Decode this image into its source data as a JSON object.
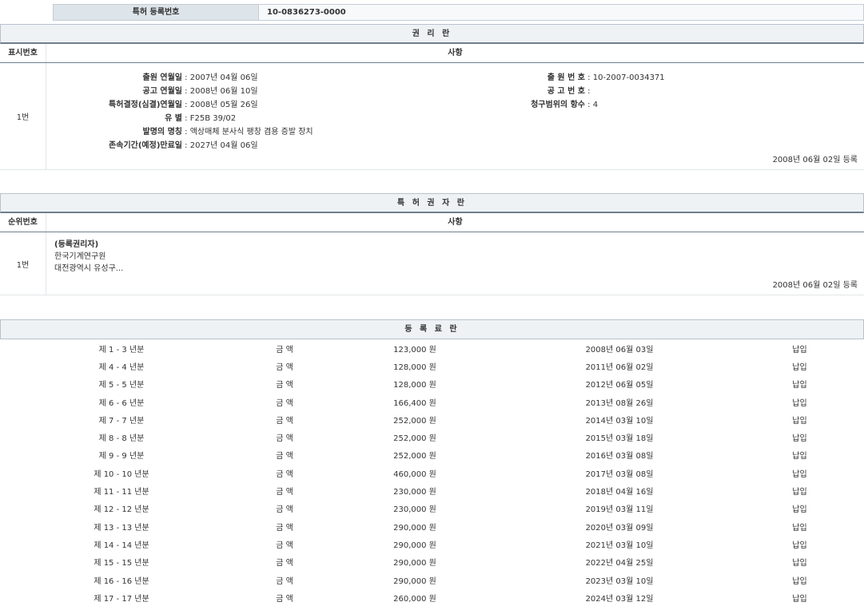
{
  "registration": {
    "label": "특허 등록번호",
    "value": "10-0836273-0000"
  },
  "rights": {
    "title": "권 리 란",
    "col_num": "표시번호",
    "col_item": "사항",
    "row_num": "1번",
    "fields_left": [
      {
        "key": "출원 연월일",
        "value": "2007년 04월 06일"
      },
      {
        "key": "공고 연월일",
        "value": "2008년 06월 10일"
      },
      {
        "key": "특허결정(심결)연월일",
        "value": "2008년 05월 26일"
      },
      {
        "key": "유 별",
        "value": "F25B 39/02"
      },
      {
        "key": "발명의 명칭",
        "value": "액상매체 분사식 팽창 겸용 증발 장치"
      },
      {
        "key": "존속기간(예정)만료일",
        "value": "2027년 04월 06일"
      }
    ],
    "fields_right": [
      {
        "key": "출 원 번 호",
        "value": "10-2007-0034371"
      },
      {
        "key": "공 고 번 호",
        "value": ""
      },
      {
        "key": "청구범위의 항수",
        "value": "4"
      }
    ],
    "reg_date": "2008년 06월 02일 등록"
  },
  "holders": {
    "title": "특 허 권 자 란",
    "col_num": "순위번호",
    "col_item": "사항",
    "row_num": "1번",
    "role": "(등록권리자)",
    "name": "한국기계연구원",
    "address": "대전광역시 유성구...",
    "reg_date": "2008년 06월 02일 등록"
  },
  "fees": {
    "title": "등 록 료 란",
    "rows": [
      {
        "period": "제 1 - 3 년분",
        "label": "금 액",
        "amount": "123,000 원",
        "date": "2008년 06월 03일",
        "status": "납입"
      },
      {
        "period": "제 4 - 4 년분",
        "label": "금 액",
        "amount": "128,000 원",
        "date": "2011년 06월 02일",
        "status": "납입"
      },
      {
        "period": "제 5 - 5 년분",
        "label": "금 액",
        "amount": "128,000 원",
        "date": "2012년 06월 05일",
        "status": "납입"
      },
      {
        "period": "제 6 - 6 년분",
        "label": "금 액",
        "amount": "166,400 원",
        "date": "2013년 08월 26일",
        "status": "납입"
      },
      {
        "period": "제 7 - 7 년분",
        "label": "금 액",
        "amount": "252,000 원",
        "date": "2014년 03월 10일",
        "status": "납입"
      },
      {
        "period": "제 8 - 8 년분",
        "label": "금 액",
        "amount": "252,000 원",
        "date": "2015년 03월 18일",
        "status": "납입"
      },
      {
        "period": "제 9 - 9 년분",
        "label": "금 액",
        "amount": "252,000 원",
        "date": "2016년 03월 08일",
        "status": "납입"
      },
      {
        "period": "제 10 - 10 년분",
        "label": "금 액",
        "amount": "460,000 원",
        "date": "2017년 03월 08일",
        "status": "납입"
      },
      {
        "period": "제 11 - 11 년분",
        "label": "금 액",
        "amount": "230,000 원",
        "date": "2018년 04월 16일",
        "status": "납입"
      },
      {
        "period": "제 12 - 12 년분",
        "label": "금 액",
        "amount": "230,000 원",
        "date": "2019년 03월 11일",
        "status": "납입"
      },
      {
        "period": "제 13 - 13 년분",
        "label": "금 액",
        "amount": "290,000 원",
        "date": "2020년 03월 09일",
        "status": "납입"
      },
      {
        "period": "제 14 - 14 년분",
        "label": "금 액",
        "amount": "290,000 원",
        "date": "2021년 03월 10일",
        "status": "납입"
      },
      {
        "period": "제 15 - 15 년분",
        "label": "금 액",
        "amount": "290,000 원",
        "date": "2022년 04월 25일",
        "status": "납입"
      },
      {
        "period": "제 16 - 16 년분",
        "label": "금 액",
        "amount": "290,000 원",
        "date": "2023년 03월 10일",
        "status": "납입"
      },
      {
        "period": "제 17 - 17 년분",
        "label": "금 액",
        "amount": "260,000 원",
        "date": "2024년 03월 12일",
        "status": "납입"
      }
    ]
  }
}
